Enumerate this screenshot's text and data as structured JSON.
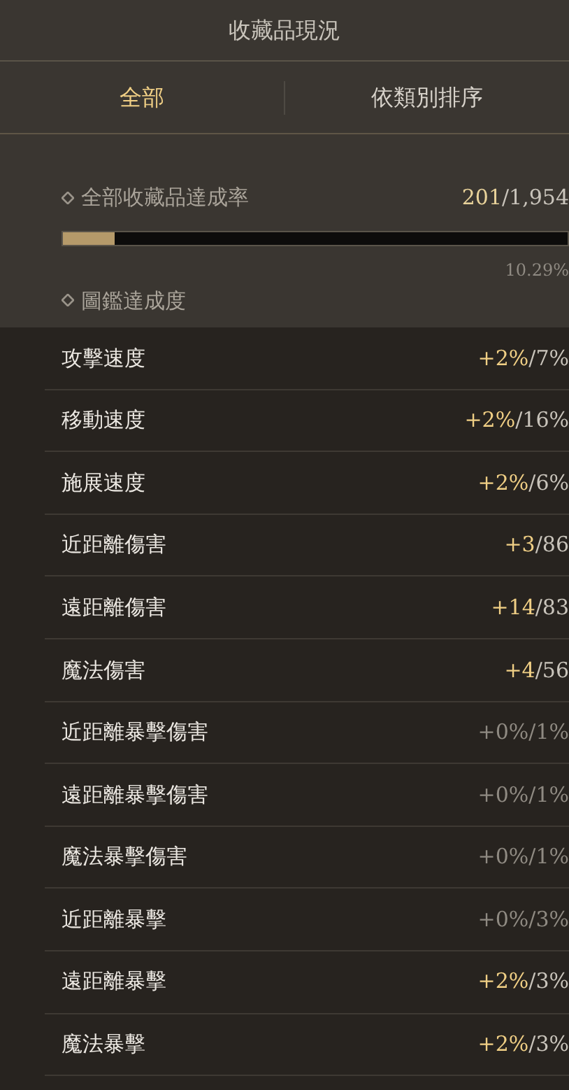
{
  "title": "收藏品現況",
  "tabs": [
    {
      "label": "全部",
      "selected": true
    },
    {
      "label": "依類別排序",
      "selected": false
    }
  ],
  "overall": {
    "label": "全部收藏品達成率",
    "count": "201",
    "total": "/1,954",
    "level": 0.103,
    "percent": "10.29%"
  },
  "codex": {
    "label": "圖鑑達成度"
  },
  "stats": [
    {
      "name": "攻擊速度",
      "gain": "+2%",
      "max": "/7%",
      "active": true
    },
    {
      "name": "移動速度",
      "gain": "+2%",
      "max": "/16%",
      "active": true
    },
    {
      "name": "施展速度",
      "gain": "+2%",
      "max": "/6%",
      "active": true
    },
    {
      "name": "近距離傷害",
      "gain": "+3",
      "max": "/86",
      "active": true
    },
    {
      "name": "遠距離傷害",
      "gain": "+14",
      "max": "/83",
      "active": true
    },
    {
      "name": "魔法傷害",
      "gain": "+4",
      "max": "/56",
      "active": true
    },
    {
      "name": "近距離暴擊傷害",
      "gain": "+0%",
      "max": "/1%",
      "active": false
    },
    {
      "name": "遠距離暴擊傷害",
      "gain": "+0%",
      "max": "/1%",
      "active": false
    },
    {
      "name": "魔法暴擊傷害",
      "gain": "+0%",
      "max": "/1%",
      "active": false
    },
    {
      "name": "近距離暴擊",
      "gain": "+0%",
      "max": "/3%",
      "active": false
    },
    {
      "name": "遠距離暴擊",
      "gain": "+2%",
      "max": "/3%",
      "active": true
    },
    {
      "name": "魔法暴擊",
      "gain": "+2%",
      "max": "/3%",
      "active": true
    }
  ]
}
